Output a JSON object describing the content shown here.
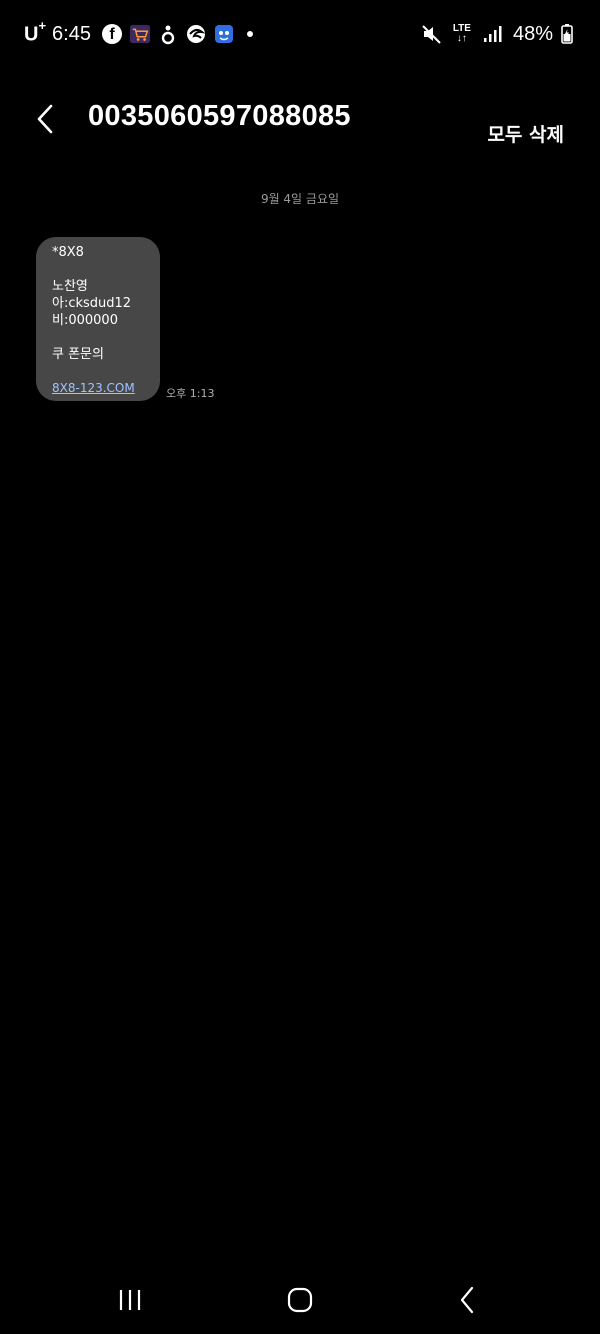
{
  "status_bar": {
    "carrier": "U",
    "carrier_plus": "+",
    "time": "6:45",
    "network": "LTE",
    "battery": "48%"
  },
  "header": {
    "title": "0035060597088085",
    "delete_all_label": "모두 삭제"
  },
  "conversation": {
    "date_separator": "9월 4일 금요일",
    "messages": [
      {
        "lines": [
          "*8X8",
          "",
          "노찬영",
          "아:cksdud12",
          "비:000000",
          "",
          "쿠 폰문의",
          ""
        ],
        "link": "8X8-123.COM",
        "time": "오후 1:13"
      }
    ]
  },
  "colors": {
    "background": "#000000",
    "bubble": "#474747",
    "link": "#9ec3ff",
    "muted_text": "#9a9a9a"
  },
  "icons": [
    "facebook-icon",
    "shopping-cart-app-icon",
    "blue-app-icon",
    "mute-icon",
    "signal-icon",
    "battery-icon",
    "back-arrow-icon",
    "recent-apps-icon",
    "home-icon",
    "nav-back-icon"
  ]
}
